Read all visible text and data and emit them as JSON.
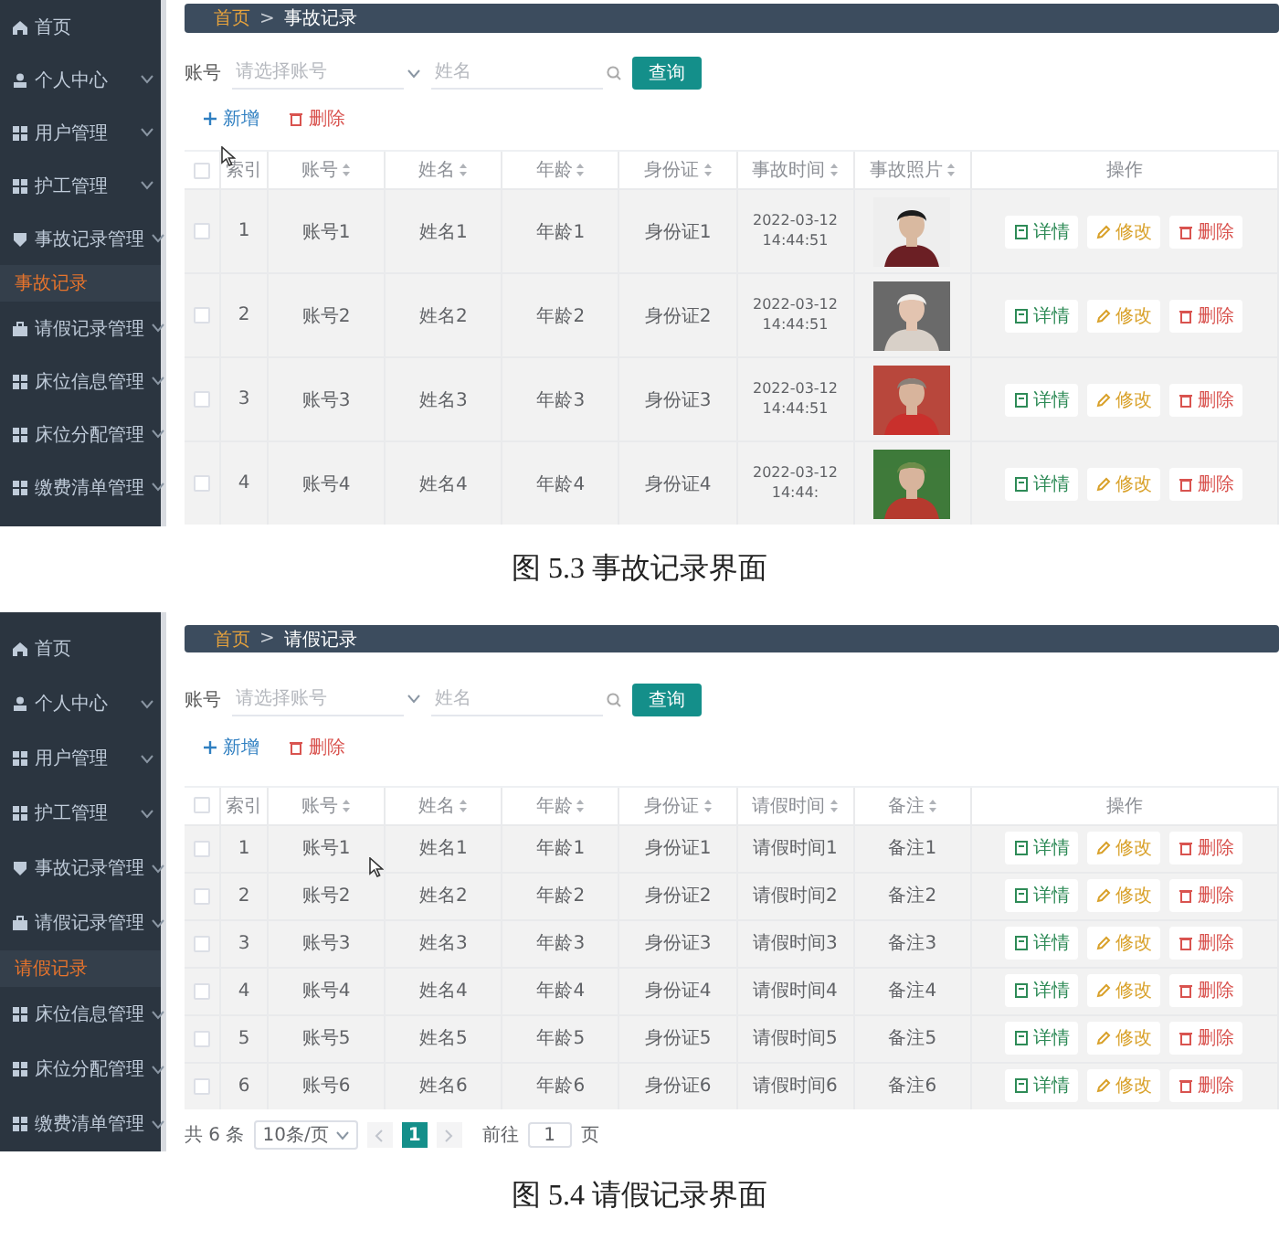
{
  "figures": [
    {
      "screen": {
        "sidebar": {
          "items": [
            {
              "label": "首页",
              "kind": "home",
              "expandable": false
            },
            {
              "label": "个人中心",
              "kind": "person",
              "expandable": true
            },
            {
              "label": "用户管理",
              "kind": "grid",
              "expandable": true
            },
            {
              "label": "护工管理",
              "kind": "grid",
              "expandable": true
            },
            {
              "label": "事故记录管理",
              "kind": "badge",
              "expandable": true,
              "children": [
                {
                  "label": "事故记录",
                  "selected": true
                }
              ]
            },
            {
              "label": "请假记录管理",
              "kind": "bag",
              "expandable": true
            },
            {
              "label": "床位信息管理",
              "kind": "grid",
              "expandable": true
            },
            {
              "label": "床位分配管理",
              "kind": "grid",
              "expandable": true
            },
            {
              "label": "缴费清单管理",
              "kind": "grid",
              "expandable": true
            }
          ]
        },
        "breadcrumb": {
          "separator": ">",
          "items": [
            {
              "label": "首页",
              "current": false
            },
            {
              "label": "事故记录",
              "current": true
            }
          ]
        },
        "search": {
          "label": "账号",
          "account_placeholder": "请选择账号",
          "name_placeholder": "姓名",
          "button": "查询"
        },
        "actions": [
          {
            "label": "新增",
            "kind": "add"
          },
          {
            "label": "删除",
            "kind": "delete"
          }
        ],
        "table": {
          "header_checked": false,
          "columns": [
            {
              "label": "索引",
              "sortable": false
            },
            {
              "label": "账号",
              "sortable": true
            },
            {
              "label": "姓名",
              "sortable": true
            },
            {
              "label": "年龄",
              "sortable": true
            },
            {
              "label": "身份证",
              "sortable": true
            },
            {
              "label": "事故时间",
              "sortable": true
            },
            {
              "label": "事故照片",
              "sortable": true
            },
            {
              "label": "操作",
              "sortable": false
            }
          ],
          "rows": [
            {
              "checked": false,
              "cells": [
                "1",
                "账号1",
                "姓名1",
                "年龄1",
                "身份证1",
                "2022-03-12 14:44:51",
                {
                  "kind": "picture"
                }
              ],
              "actions": [
                {
                  "label": "详情",
                  "kind": "detail"
                },
                {
                  "label": "修改",
                  "kind": "edit"
                },
                {
                  "label": "删除",
                  "kind": "delete"
                }
              ]
            },
            {
              "checked": false,
              "cells": [
                "2",
                "账号2",
                "姓名2",
                "年龄2",
                "身份证2",
                "2022-03-12 14:44:51",
                {
                  "kind": "picture"
                }
              ],
              "actions": [
                {
                  "label": "详情",
                  "kind": "detail"
                },
                {
                  "label": "修改",
                  "kind": "edit"
                },
                {
                  "label": "删除",
                  "kind": "delete"
                }
              ]
            },
            {
              "checked": false,
              "cells": [
                "3",
                "账号3",
                "姓名3",
                "年龄3",
                "身份证3",
                "2022-03-12 14:44:51",
                {
                  "kind": "picture"
                }
              ],
              "actions": [
                {
                  "label": "详情",
                  "kind": "detail"
                },
                {
                  "label": "修改",
                  "kind": "edit"
                },
                {
                  "label": "删除",
                  "kind": "delete"
                }
              ]
            },
            {
              "checked": false,
              "cells": [
                "4",
                "账号4",
                "姓名4",
                "年龄4",
                "身份证4",
                "2022-03-12 14:44:",
                {
                  "kind": "picture"
                }
              ],
              "actions": [
                {
                  "label": "详情",
                  "kind": "detail"
                },
                {
                  "label": "修改",
                  "kind": "edit"
                },
                {
                  "label": "删除",
                  "kind": "delete"
                }
              ]
            }
          ]
        }
      },
      "caption": "图 5.3 事故记录界面"
    },
    {
      "screen": {
        "sidebar": {
          "items": [
            {
              "label": "首页",
              "kind": "home",
              "expandable": false
            },
            {
              "label": "个人中心",
              "kind": "person",
              "expandable": true
            },
            {
              "label": "用户管理",
              "kind": "grid",
              "expandable": true
            },
            {
              "label": "护工管理",
              "kind": "grid",
              "expandable": true
            },
            {
              "label": "事故记录管理",
              "kind": "badge",
              "expandable": true
            },
            {
              "label": "请假记录管理",
              "kind": "bag",
              "expandable": true,
              "children": [
                {
                  "label": "请假记录",
                  "selected": true
                }
              ]
            },
            {
              "label": "床位信息管理",
              "kind": "grid",
              "expandable": true
            },
            {
              "label": "床位分配管理",
              "kind": "grid",
              "expandable": true
            },
            {
              "label": "缴费清单管理",
              "kind": "grid",
              "expandable": true
            }
          ]
        },
        "breadcrumb": {
          "separator": ">",
          "items": [
            {
              "label": "首页",
              "current": false
            },
            {
              "label": "请假记录",
              "current": true
            }
          ]
        },
        "search": {
          "label": "账号",
          "account_placeholder": "请选择账号",
          "name_placeholder": "姓名",
          "button": "查询"
        },
        "actions": [
          {
            "label": "新增",
            "kind": "add"
          },
          {
            "label": "删除",
            "kind": "delete"
          }
        ],
        "table": {
          "header_checked": false,
          "columns": [
            {
              "label": "索引",
              "sortable": false
            },
            {
              "label": "账号",
              "sortable": true
            },
            {
              "label": "姓名",
              "sortable": true
            },
            {
              "label": "年龄",
              "sortable": true
            },
            {
              "label": "身份证",
              "sortable": true
            },
            {
              "label": "请假时间",
              "sortable": true
            },
            {
              "label": "备注",
              "sortable": true
            },
            {
              "label": "操作",
              "sortable": false
            }
          ],
          "rows": [
            {
              "checked": false,
              "cells": [
                "1",
                "账号1",
                "姓名1",
                "年龄1",
                "身份证1",
                "请假时间1",
                "备注1"
              ],
              "actions": [
                {
                  "label": "详情",
                  "kind": "detail"
                },
                {
                  "label": "修改",
                  "kind": "edit"
                },
                {
                  "label": "删除",
                  "kind": "delete"
                }
              ]
            },
            {
              "checked": false,
              "cells": [
                "2",
                "账号2",
                "姓名2",
                "年龄2",
                "身份证2",
                "请假时间2",
                "备注2"
              ],
              "actions": [
                {
                  "label": "详情",
                  "kind": "detail"
                },
                {
                  "label": "修改",
                  "kind": "edit"
                },
                {
                  "label": "删除",
                  "kind": "delete"
                }
              ]
            },
            {
              "checked": false,
              "cells": [
                "3",
                "账号3",
                "姓名3",
                "年龄3",
                "身份证3",
                "请假时间3",
                "备注3"
              ],
              "actions": [
                {
                  "label": "详情",
                  "kind": "detail"
                },
                {
                  "label": "修改",
                  "kind": "edit"
                },
                {
                  "label": "删除",
                  "kind": "delete"
                }
              ]
            },
            {
              "checked": false,
              "cells": [
                "4",
                "账号4",
                "姓名4",
                "年龄4",
                "身份证4",
                "请假时间4",
                "备注4"
              ],
              "actions": [
                {
                  "label": "详情",
                  "kind": "detail"
                },
                {
                  "label": "修改",
                  "kind": "edit"
                },
                {
                  "label": "删除",
                  "kind": "delete"
                }
              ]
            },
            {
              "checked": false,
              "cells": [
                "5",
                "账号5",
                "姓名5",
                "年龄5",
                "身份证5",
                "请假时间5",
                "备注5"
              ],
              "actions": [
                {
                  "label": "详情",
                  "kind": "detail"
                },
                {
                  "label": "修改",
                  "kind": "edit"
                },
                {
                  "label": "删除",
                  "kind": "delete"
                }
              ]
            },
            {
              "checked": false,
              "cells": [
                "6",
                "账号6",
                "姓名6",
                "年龄6",
                "身份证6",
                "请假时间6",
                "备注6"
              ],
              "actions": [
                {
                  "label": "详情",
                  "kind": "detail"
                },
                {
                  "label": "修改",
                  "kind": "edit"
                },
                {
                  "label": "删除",
                  "kind": "delete"
                }
              ]
            }
          ]
        },
        "pagination": {
          "total": "共 6 条",
          "page_size": "10条/页",
          "pages": [
            {
              "label": "1",
              "selected": true
            }
          ],
          "goto_label": "前往",
          "goto_value": "1",
          "page_suffix": "页"
        }
      },
      "caption": "图 5.4 请假记录界面"
    }
  ]
}
